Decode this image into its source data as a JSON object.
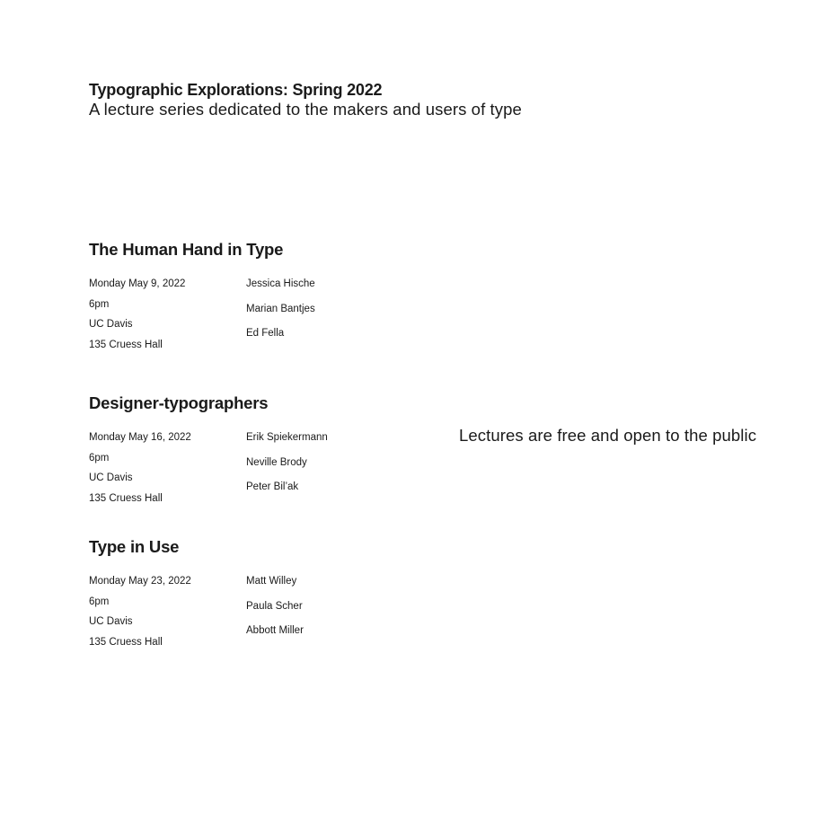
{
  "header": {
    "title": "Typographic Explorations: Spring 2022",
    "subtitle": "A lecture series dedicated to the makers and users of type"
  },
  "lectures": [
    {
      "title": "The Human Hand in Type",
      "date": "Monday May 9, 2022",
      "time": "6pm",
      "venue": "UC Davis",
      "room": "135 Cruess Hall",
      "speakers": [
        "Jessica Hische",
        "Marian Bantjes",
        "Ed Fella"
      ]
    },
    {
      "title": "Designer-typographers",
      "date": "Monday May 16, 2022",
      "time": "6pm",
      "venue": "UC Davis",
      "room": "135 Cruess Hall",
      "speakers": [
        "Erik Spiekermann",
        "Neville Brody",
        "Peter Bil’ak"
      ]
    },
    {
      "title": "Type in Use",
      "date": "Monday May 23, 2022",
      "time": "6pm",
      "venue": "UC Davis",
      "room": "135 Cruess Hall",
      "speakers": [
        "Matt Willey",
        "Paula Scher",
        "Abbott Miller"
      ]
    }
  ],
  "note": "Lectures are free and open to the public"
}
